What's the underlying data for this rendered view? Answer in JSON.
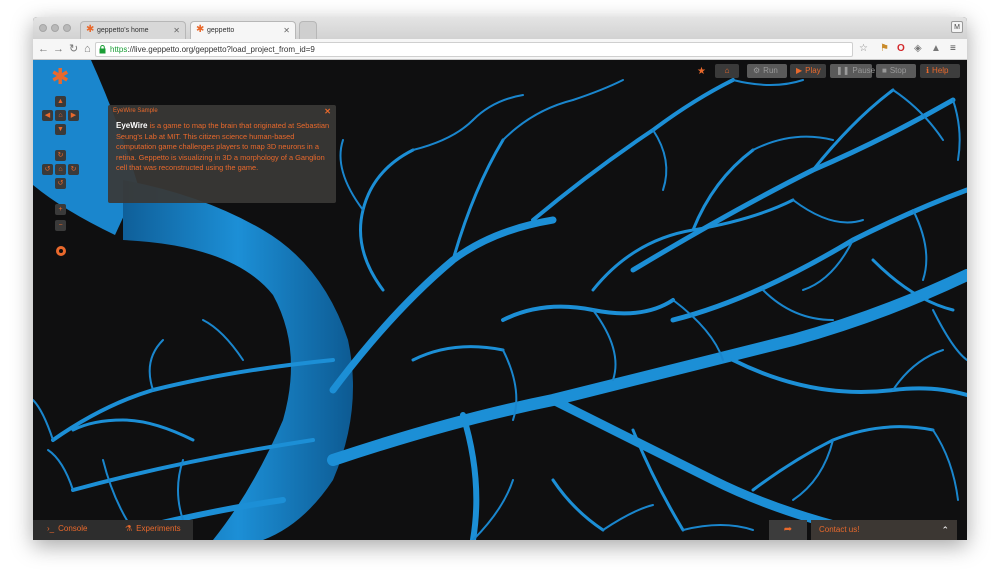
{
  "browser": {
    "tabs": [
      {
        "title": "geppetto's home",
        "favicon": "geppetto-star-icon",
        "active": false
      },
      {
        "title": "geppetto",
        "favicon": "geppetto-star-icon",
        "active": true
      }
    ],
    "profile_initial": "M",
    "url_scheme": "https",
    "url_rest": "://live.geppetto.org/geppetto?load_project_from_id=9",
    "nav_icons": [
      "back-arrow-icon",
      "forward-arrow-icon",
      "reload-icon",
      "home-icon"
    ],
    "extension_icons": [
      "bookmark-star-icon",
      "extension-icon",
      "opera-icon",
      "cube-icon",
      "drive-icon",
      "menu-icon"
    ]
  },
  "viewer": {
    "popup": {
      "title": "EyeWire Sample",
      "lead": "EyeWire",
      "body": " is a game to map the brain that originated at Sebastian Seung's Lab at MIT. This citizen science human-based computation game challenges players to map 3D neurons in a retina. Geppetto is visualizing in 3D a morphology of a Ganglion cell that was reconstructed using the game."
    },
    "controls": {
      "run": "Run",
      "play": "Play",
      "pause": "Pause",
      "stop": "Stop",
      "help": "Help"
    },
    "bottom": {
      "console": "Console",
      "experiments": "Experiments",
      "contact": "Contact us!"
    }
  },
  "colors": {
    "accent": "#e9692c",
    "neuron": "#1c8fd6",
    "background": "#0f0f10",
    "popup_bg": "#3a3836"
  }
}
